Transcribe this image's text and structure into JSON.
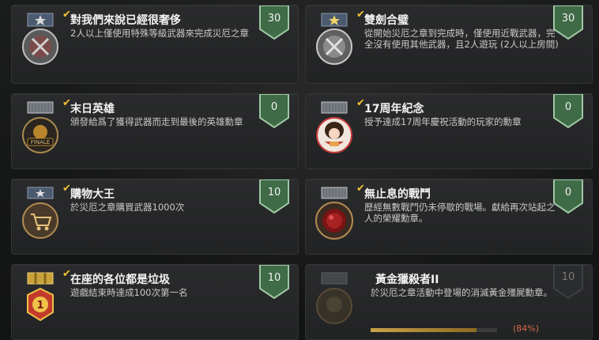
{
  "achievements": [
    {
      "title": "對我們來說已經很奢侈",
      "description": "2人以上僅使用特殊等級武器來完成災厄之章",
      "points": "30",
      "completed": true,
      "icon": "silver-crest-medal-icon"
    },
    {
      "title": "雙劍合璧",
      "description": "從開始災厄之章到完成時，僅使用近戰武器，完全沒有使用其他武器，且2人遊玩 (2人以上房間)",
      "points": "30",
      "completed": true,
      "icon": "silver-crest-medal-icon"
    },
    {
      "title": "末日英雄",
      "description": "頒發給爲了獲得武器而走到最後的英雄勳章",
      "points": "0",
      "completed": true,
      "icon": "finale-medal-icon"
    },
    {
      "title": "17周年紀念",
      "description": "授予達成17周年慶祝活動的玩家的勳章",
      "points": "0",
      "completed": true,
      "icon": "anniversary-girl-medal-icon"
    },
    {
      "title": "購物大王",
      "description": "於災厄之章購買武器1000次",
      "points": "10",
      "completed": true,
      "icon": "shopping-cart-medal-icon"
    },
    {
      "title": "無止息的戰鬥",
      "description": "歷經無數戰鬥仍未停歇的戰場。獻給再次站起之人的榮耀勳章。",
      "points": "0",
      "completed": true,
      "icon": "red-orb-medal-icon"
    },
    {
      "title": "在座的各位都是垃圾",
      "description": "遊戲結束時達成100次第一名",
      "points": "10",
      "completed": true,
      "icon": "first-place-medal-icon"
    },
    {
      "title": "黃金獵殺者II",
      "description": "於災厄之章活動中登場的消滅黃金殭屍勳章。",
      "points": "10",
      "completed": false,
      "icon": "gold-hunter-medal-icon",
      "progress": 0.84,
      "progress_label": "(84%)"
    }
  ],
  "colors": {
    "badge_green": "#3f6b47",
    "badge_locked": "#2b2c2d",
    "check_gold": "#f2c232",
    "progress_text": "#d06a48"
  }
}
